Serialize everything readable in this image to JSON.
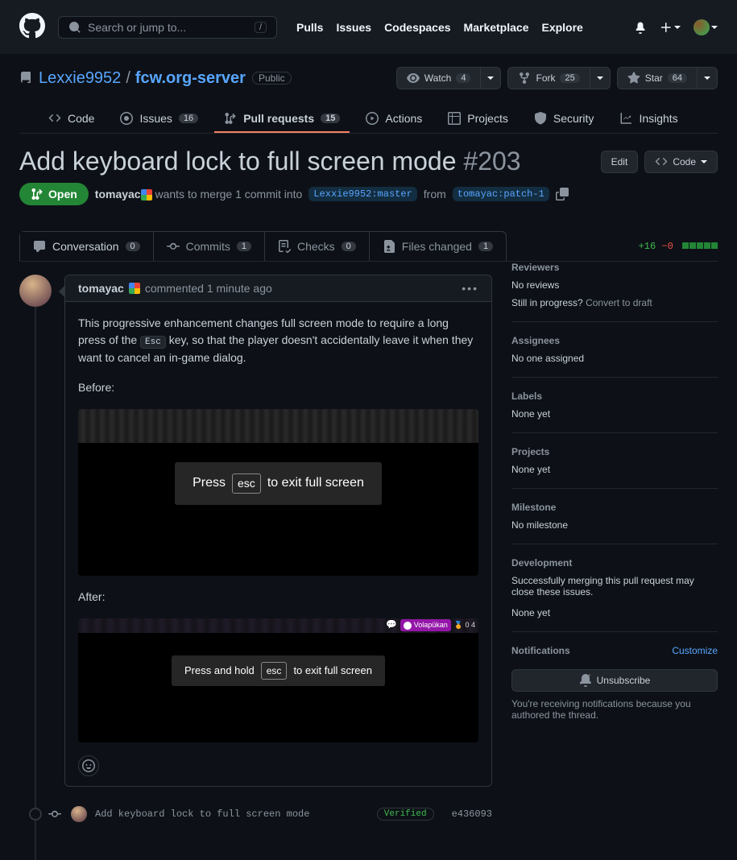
{
  "header": {
    "search_placeholder": "Search or jump to...",
    "slash": "/",
    "nav": {
      "pulls": "Pulls",
      "issues": "Issues",
      "codespaces": "Codespaces",
      "marketplace": "Marketplace",
      "explore": "Explore"
    }
  },
  "repo": {
    "owner": "Lexxie9952",
    "name": "fcw.org-server",
    "visibility": "Public",
    "actions": {
      "watch": "Watch",
      "watch_count": "4",
      "fork": "Fork",
      "fork_count": "25",
      "star": "Star",
      "star_count": "64"
    },
    "tabs": {
      "code": "Code",
      "issues": "Issues",
      "issues_count": "16",
      "pulls": "Pull requests",
      "pulls_count": "15",
      "actions": "Actions",
      "projects": "Projects",
      "security": "Security",
      "insights": "Insights"
    }
  },
  "pr": {
    "title": "Add keyboard lock to full screen mode",
    "number": "#203",
    "edit": "Edit",
    "code": "Code",
    "state": "Open",
    "author": "tomayac",
    "merge_text_1": "wants to merge 1 commit into",
    "base_branch": "Lexxie9952:master",
    "merge_text_2": "from",
    "head_branch": "tomayac:patch-1",
    "tabs": {
      "conversation": "Conversation",
      "conversation_count": "0",
      "commits": "Commits",
      "commits_count": "1",
      "checks": "Checks",
      "checks_count": "0",
      "files": "Files changed",
      "files_count": "1"
    },
    "diffstat": {
      "add": "+16",
      "del": "−0"
    }
  },
  "comment": {
    "author": "tomayac",
    "meta": "commented 1 minute ago",
    "body_p1a": "This progressive enhancement changes full screen mode to require a long press of the ",
    "body_p1_key": "Esc",
    "body_p1b": " key, so that the player doesn't accidentally leave it when they want to cancel an in-game dialog.",
    "before_label": "Before:",
    "after_label": "After:",
    "demo1_a": "Press",
    "demo1_key": "esc",
    "demo1_b": "to exit full screen",
    "demo2_a": "Press and hold",
    "demo2_key": "esc",
    "demo2_b": "to exit full screen",
    "demo2_badge": "Volapükan",
    "demo2_stats": "0   4"
  },
  "commit": {
    "message": "Add keyboard lock to full screen mode",
    "verified": "Verified",
    "sha": "e436093"
  },
  "sidebar": {
    "reviewers": {
      "title": "Reviewers",
      "none": "No reviews",
      "progress_q": "Still in progress?",
      "convert": "Convert to draft"
    },
    "assignees": {
      "title": "Assignees",
      "none": "No one assigned"
    },
    "labels": {
      "title": "Labels",
      "none": "None yet"
    },
    "projects": {
      "title": "Projects",
      "none": "None yet"
    },
    "milestone": {
      "title": "Milestone",
      "none": "No milestone"
    },
    "development": {
      "title": "Development",
      "text": "Successfully merging this pull request may close these issues.",
      "none": "None yet"
    },
    "notifications": {
      "title": "Notifications",
      "customize": "Customize",
      "unsubscribe": "Unsubscribe",
      "reason": "You're receiving notifications because you authored the thread."
    }
  }
}
